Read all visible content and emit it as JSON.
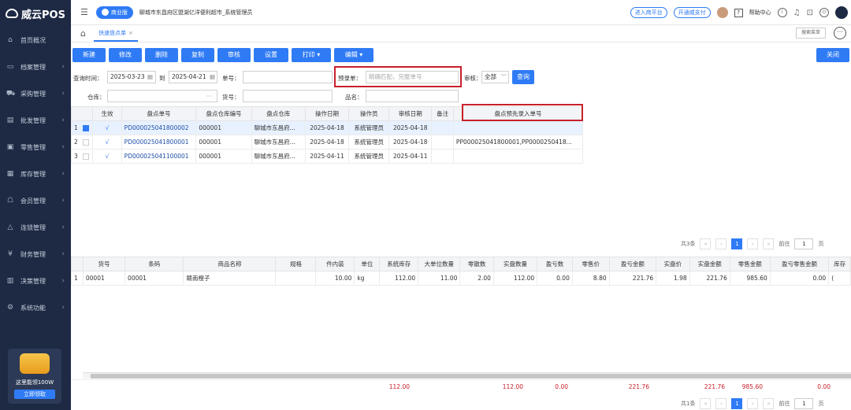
{
  "app": {
    "name": "威云POS"
  },
  "sidebar": {
    "items": [
      {
        "label": "首页概况",
        "icon": "home-icon",
        "glyph": "⌂"
      },
      {
        "label": "档案管理",
        "icon": "folder-icon",
        "glyph": "▭"
      },
      {
        "label": "采购管理",
        "icon": "cart-icon",
        "glyph": "⛟"
      },
      {
        "label": "批发管理",
        "icon": "building-icon",
        "glyph": "▤"
      },
      {
        "label": "零售管理",
        "icon": "store-icon",
        "glyph": "▣"
      },
      {
        "label": "库存管理",
        "icon": "inventory-icon",
        "glyph": "▦"
      },
      {
        "label": "会员管理",
        "icon": "member-icon",
        "glyph": "☖"
      },
      {
        "label": "连锁管理",
        "icon": "chain-icon",
        "glyph": "△"
      },
      {
        "label": "财务管理",
        "icon": "finance-icon",
        "glyph": "¥"
      },
      {
        "label": "决策管理",
        "icon": "chart-icon",
        "glyph": "▥"
      },
      {
        "label": "系统功能",
        "icon": "gear-icon",
        "glyph": "⚙"
      }
    ],
    "promo": {
      "text": "这里能领100W",
      "button": "立即领取"
    }
  },
  "topbar": {
    "edition": "商业版",
    "store": "聊城市东昌府区盟湖亿洋便利超市_系统管理员",
    "enter_platform": "进入商平台",
    "open_wallet": "开通威支付",
    "help": "帮助中心"
  },
  "tabs": {
    "active": "快速盘点单",
    "close": "×",
    "search_menu": "搜索菜单"
  },
  "toolbar": {
    "new": "新建",
    "edit": "修改",
    "delete": "删除",
    "copy": "复制",
    "audit": "审核",
    "settings": "设置",
    "print": "打印",
    "print_arrow": "▾",
    "edit_menu": "编辑",
    "edit_arrow": "▾",
    "close": "关闭"
  },
  "filters": {
    "query_time_label": "查询时间：",
    "date_from": "2025-03-23",
    "to": "到",
    "date_to": "2025-04-21",
    "doc_no_label": "单号：",
    "prerecord_label": "预录单：",
    "prerecord_placeholder": "精确匹配，完整单号",
    "audit_label": "审核：",
    "audit_value": "全部",
    "query": "查询",
    "warehouse_label": "仓库：",
    "ellipsis": "···",
    "item_no_label": "货号：",
    "item_name_label": "品名："
  },
  "main_table": {
    "headers": [
      "",
      "生效",
      "盘点单号",
      "盘点仓库编号",
      "盘点仓库",
      "操作日期",
      "操作员",
      "审核日期",
      "备注",
      "盘点预先录入单号"
    ],
    "rows": [
      {
        "idx": "1",
        "checked": true,
        "effective": "√",
        "doc": "PD000025041800002",
        "wh_code": "000001",
        "wh": "聊城市东昌府...",
        "op_date": "2025-04-18",
        "operator": "系统管理员",
        "audit_date": "2025-04-18",
        "remark": "",
        "pre": ""
      },
      {
        "idx": "2",
        "checked": false,
        "effective": "√",
        "doc": "PD000025041800001",
        "wh_code": "000001",
        "wh": "聊城市东昌府...",
        "op_date": "2025-04-18",
        "operator": "系统管理员",
        "audit_date": "2025-04-18",
        "remark": "",
        "pre": "PP000025041800001,PP0000250418..."
      },
      {
        "idx": "3",
        "checked": false,
        "effective": "√",
        "doc": "PD000025041100001",
        "wh_code": "000001",
        "wh": "聊城市东昌府...",
        "op_date": "2025-04-11",
        "operator": "系统管理员",
        "audit_date": "2025-04-11",
        "remark": "",
        "pre": ""
      }
    ]
  },
  "pager1": {
    "total": "共3条",
    "page": "1",
    "goto": "前往",
    "goto_value": "1",
    "unit": "页",
    "prev": "‹",
    "next": "›",
    "first": "«",
    "last": "»"
  },
  "detail_table": {
    "headers": [
      "",
      "货号",
      "条码",
      "商品名称",
      "规格",
      "件内装",
      "单位",
      "系统库存",
      "大单位数量",
      "零散数",
      "实盘数量",
      "盈亏数",
      "零售价",
      "盈亏金额",
      "实盘价",
      "实盘金额",
      "零售金额",
      "盈亏零售金额",
      "库存"
    ],
    "rows": [
      [
        "1",
        "00001",
        "00001",
        "赣南橙子",
        "",
        "10.00",
        "kg",
        "112.00",
        "11.00",
        "2.00",
        "112.00",
        "0.00",
        "8.80",
        "221.76",
        "1.98",
        "221.76",
        "985.60",
        "0.00",
        "("
      ]
    ]
  },
  "totals": {
    "sys_stock": "112.00",
    "actual_qty": "112.00",
    "profit_qty": "0.00",
    "profit_amount": "221.76",
    "actual_amount": "221.76",
    "retail_amount": "985.60",
    "profit_retail": "0.00"
  },
  "pager2": {
    "total": "共1条",
    "page": "1",
    "goto": "前往",
    "goto_value": "1",
    "unit": "页",
    "prev": "‹",
    "next": "›",
    "first": "«",
    "last": "»"
  }
}
